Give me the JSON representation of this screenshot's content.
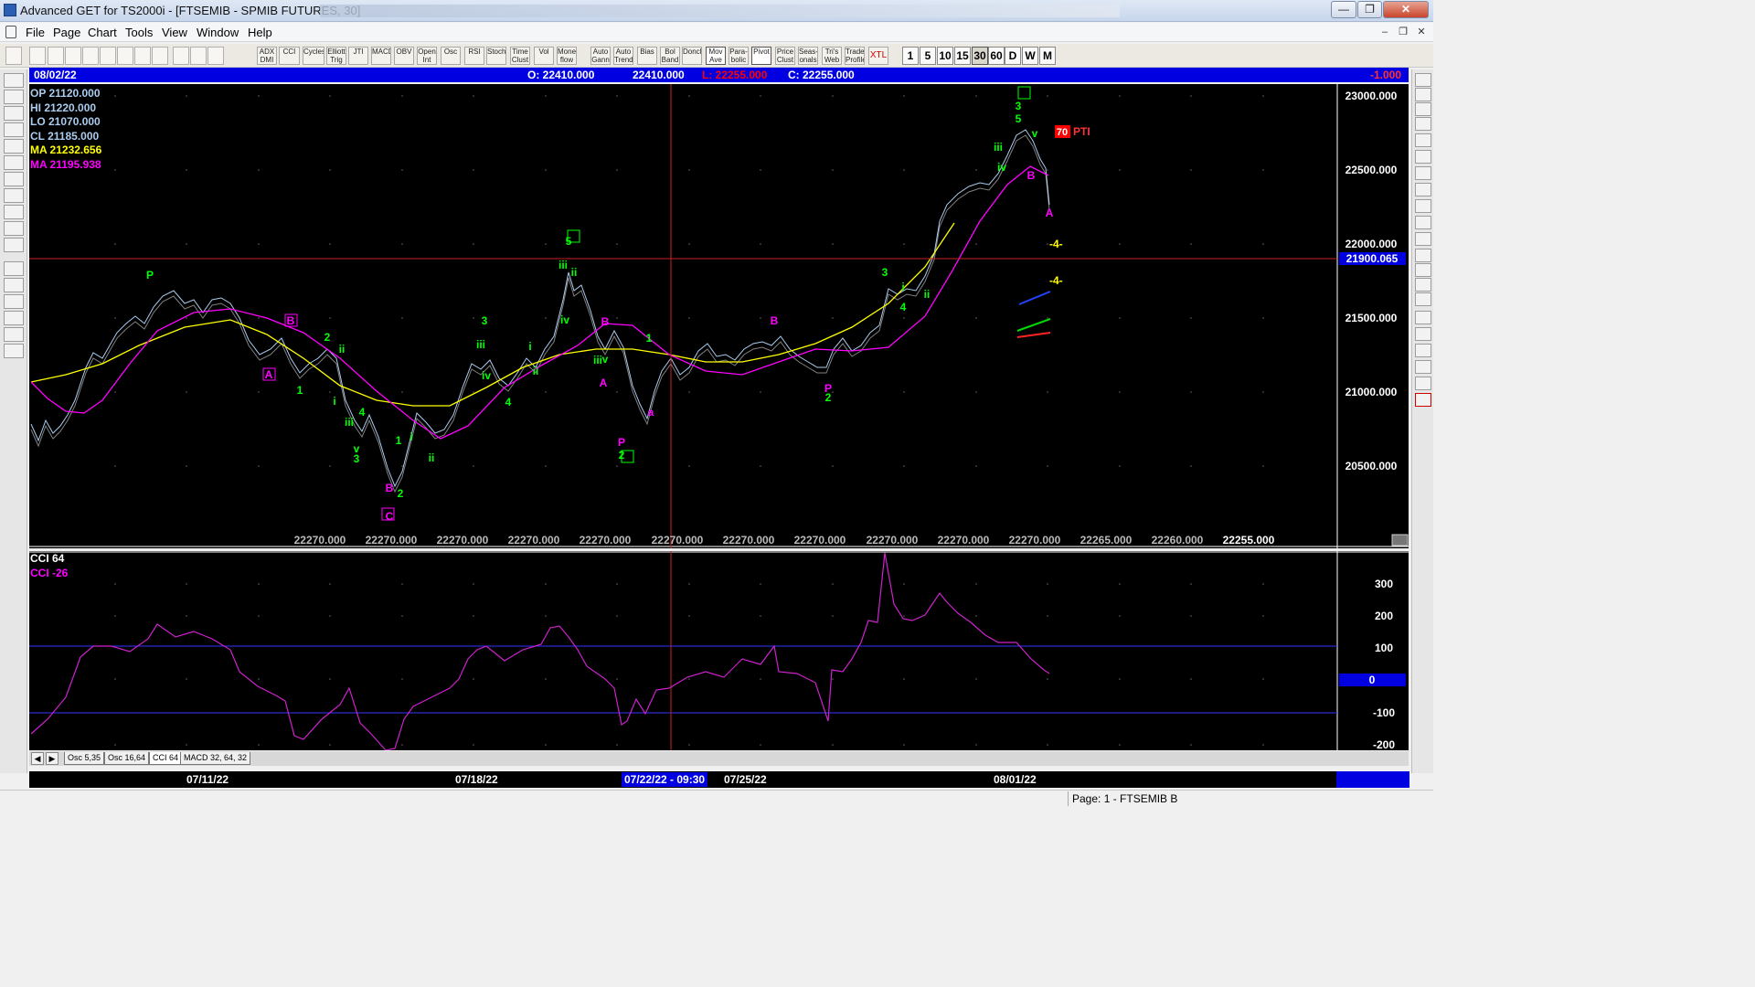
{
  "window": {
    "title": "Advanced GET for TS2000i - [FTSEMIB - SPMIB FUTURES, 30]"
  },
  "menu": [
    "File",
    "Page",
    "Chart",
    "Tools",
    "View",
    "Window",
    "Help"
  ],
  "toolbar": {
    "indicator_buttons": [
      "ADX DMI",
      "CCI",
      "Cycles",
      "Elliott Trig",
      "JTI",
      "MACD",
      "OBV",
      "Open Int",
      "Osc",
      "RSI",
      "Stoch",
      "Time Clust",
      "Vol",
      "Money flow",
      "Auto Gann",
      "Auto Trend",
      "Bias",
      "Bol Band",
      "Donch",
      "Mov Ave",
      "Para-bolic",
      "Pivot",
      "Price Clust",
      "Seas-onals",
      "Tri's Web",
      "Trade Profile",
      "XTL"
    ],
    "timeframes": [
      "1",
      "5",
      "10",
      "15",
      "30",
      "60",
      "D",
      "W",
      "M"
    ],
    "active_timeframe": "30"
  },
  "infobar": {
    "date": "08/02/22",
    "open": "O: 22410.000",
    "high": "22410.000",
    "low": "L:  22255.000",
    "close": "C:  22255.000",
    "change": "-1.000",
    "colors": {
      "background": "#0000e0",
      "low": "#ff0000",
      "change": "#ff3333"
    }
  },
  "legend": {
    "op": "OP  21120.000",
    "hi": "HI    21220.000",
    "lo": "LO   21070.000",
    "cl": "CL   21185.000",
    "ma1": "MA  21232.656",
    "ma2": "MA  21195.938",
    "colors": {
      "price": "#aaccee",
      "ma_yellow": "#ffff00",
      "ma_magenta": "#ff00ff"
    }
  },
  "price_axis": {
    "labels": [
      "23000.000",
      "22500.000",
      "22000.000",
      "21500.000",
      "21000.000",
      "20500.000"
    ],
    "cursor_label": "21900.065"
  },
  "bottom_price_row": [
    "22270.000",
    "22270.000",
    "22270.000",
    "22270.000",
    "22270.000",
    "22270.000",
    "22270.000",
    "22270.000",
    "22270.000",
    "22270.000",
    "22270.000",
    "22265.000",
    "22260.000",
    "22255.000"
  ],
  "annotations": {
    "pti_value": "70",
    "pti_label": "PTI",
    "target_label": "-4-"
  },
  "wave_labels": [
    {
      "t": "P",
      "c": "#00ff00"
    },
    {
      "t": "B",
      "c": "#ff00ff"
    },
    {
      "t": "A",
      "c": "#ff00ff"
    },
    {
      "t": "2",
      "c": "#00ff00"
    },
    {
      "t": "ii",
      "c": "#00ff00"
    },
    {
      "t": "1",
      "c": "#00ff00"
    },
    {
      "t": "i",
      "c": "#00ff00"
    },
    {
      "t": "iii",
      "c": "#00ff00"
    },
    {
      "t": "4",
      "c": "#00ff00"
    },
    {
      "t": "v",
      "c": "#00ff00"
    },
    {
      "t": "3",
      "c": "#00ff00"
    },
    {
      "t": "B",
      "c": "#ff00ff"
    },
    {
      "t": "C",
      "c": "#ff00ff"
    },
    {
      "t": "2",
      "c": "#00ff00"
    },
    {
      "t": "i",
      "c": "#00ff00"
    },
    {
      "t": "1",
      "c": "#00ff00"
    },
    {
      "t": "ii",
      "c": "#00ff00"
    },
    {
      "t": "3",
      "c": "#00ff00"
    },
    {
      "t": "iii",
      "c": "#00ff00"
    },
    {
      "t": "iv",
      "c": "#00ff00"
    },
    {
      "t": "4",
      "c": "#00ff00"
    },
    {
      "t": "i",
      "c": "#00ff00"
    },
    {
      "t": "ii",
      "c": "#00ff00"
    },
    {
      "t": "1",
      "c": "#00ff00"
    },
    {
      "t": "5",
      "c": "#00ff00"
    },
    {
      "t": "iii",
      "c": "#00ff00"
    },
    {
      "t": "ii",
      "c": "#00ff00"
    },
    {
      "t": "iv",
      "c": "#00ff00"
    },
    {
      "t": "B",
      "c": "#ff00ff"
    },
    {
      "t": "iii",
      "c": "#00ff00"
    },
    {
      "t": "v",
      "c": "#00ff00"
    },
    {
      "t": "A",
      "c": "#ff00ff"
    },
    {
      "t": "P",
      "c": "#ff00ff"
    },
    {
      "t": "2",
      "c": "#00ff00"
    },
    {
      "t": "1",
      "c": "#00ff00"
    },
    {
      "t": "a",
      "c": "#ff00ff"
    },
    {
      "t": "B",
      "c": "#ff00ff"
    },
    {
      "t": "P",
      "c": "#ff00ff"
    },
    {
      "t": "2",
      "c": "#00ff00"
    },
    {
      "t": "3",
      "c": "#00ff00"
    },
    {
      "t": "i",
      "c": "#00ff00"
    },
    {
      "t": "ii",
      "c": "#00ff00"
    },
    {
      "t": "4",
      "c": "#00ff00"
    },
    {
      "t": "iii",
      "c": "#00ff00"
    },
    {
      "t": "iv",
      "c": "#00ff00"
    },
    {
      "t": "3",
      "c": "#00ff00"
    },
    {
      "t": "5",
      "c": "#00ff00"
    },
    {
      "t": "v",
      "c": "#00ff00"
    },
    {
      "t": "B",
      "c": "#ff00ff"
    },
    {
      "t": "A",
      "c": "#ff00ff"
    },
    {
      "t": "C",
      "c": "#ff00ff"
    }
  ],
  "cci": {
    "label1": "CCI 64",
    "label2": "CCI  -26",
    "axis_labels": [
      "300",
      "200",
      "100",
      "0",
      "-100",
      "-200"
    ],
    "cursor_value": "0"
  },
  "tabs": {
    "items": [
      "Osc 5,35",
      "Osc 16,64",
      "CCI 64",
      "MACD 32, 64, 32"
    ],
    "active": "CCI 64"
  },
  "dates": {
    "labels": [
      "07/11/22",
      "07/18/22",
      "07/25/22",
      "08/01/22"
    ],
    "cursor": "07/22/22 - 09:30"
  },
  "status": {
    "page": "Page: 1 - FTSEMIB B"
  }
}
